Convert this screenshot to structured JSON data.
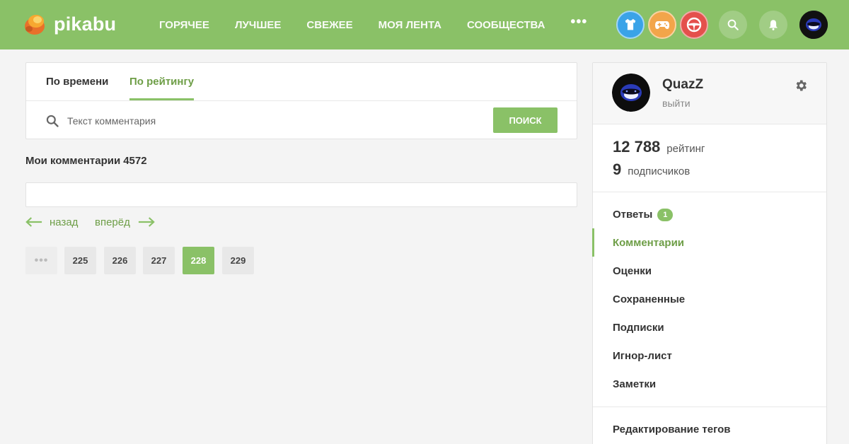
{
  "header": {
    "logo_text": "pikabu",
    "nav": [
      "Горячее",
      "Лучшее",
      "Свежее",
      "Моя лента",
      "Сообщества"
    ],
    "more": "•••",
    "colors": {
      "header_bg": "#8ac167",
      "shirt": "#3aa3e8",
      "games": "#f2a54a",
      "cars": "#e4504c"
    }
  },
  "tabs": {
    "by_time": "По времени",
    "by_rating": "По рейтингу"
  },
  "search": {
    "placeholder": "Текст комментария",
    "button": "Поиск"
  },
  "comments": {
    "title": "Мои комментарии",
    "count": "4572"
  },
  "pager": {
    "back": "назад",
    "forward": "вперёд",
    "pages": [
      "•••",
      "225",
      "226",
      "227",
      "228",
      "229"
    ],
    "active_page": "228"
  },
  "profile": {
    "username": "QuazZ",
    "logout": "выйти",
    "rating_value": "12 788",
    "rating_label": "рейтинг",
    "subscribers_value": "9",
    "subscribers_label": "подписчиков"
  },
  "menu": {
    "answers": "Ответы",
    "answers_badge": "1",
    "comments": "Комментарии",
    "ratings": "Оценки",
    "saved": "Сохраненные",
    "subscriptions": "Подписки",
    "ignore": "Игнор-лист",
    "notes": "Заметки",
    "edit_tags": "Редактирование тегов"
  },
  "icons": [
    "search-icon",
    "bell-icon",
    "gear-icon",
    "shirt-icon",
    "gamepad-icon",
    "steering-wheel-icon",
    "arrow-left-icon",
    "arrow-right-icon"
  ]
}
